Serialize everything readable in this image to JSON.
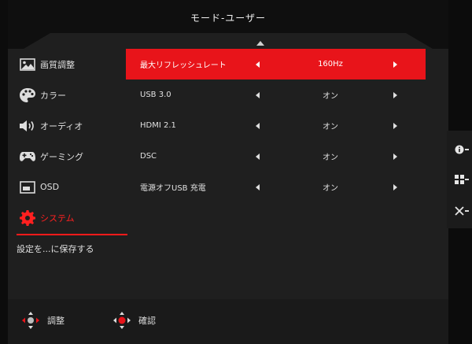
{
  "header": {
    "title": "モード-ユーザー"
  },
  "sidebar": {
    "items": [
      {
        "label": "画質調整",
        "icon": "image-icon"
      },
      {
        "label": "カラー",
        "icon": "palette-icon"
      },
      {
        "label": "オーディオ",
        "icon": "speaker-icon"
      },
      {
        "label": "ゲーミング",
        "icon": "gamepad-icon"
      },
      {
        "label": "OSD",
        "icon": "osd-window-icon"
      },
      {
        "label": "システム",
        "icon": "gear-icon",
        "active": true
      }
    ],
    "save_label": "設定を...に保存する"
  },
  "settings": {
    "rows": [
      {
        "label": "最大リフレッシュレート",
        "value": "160Hz",
        "active": true
      },
      {
        "label": "USB 3.0",
        "value": "オン"
      },
      {
        "label": "HDMI 2.1",
        "value": "オン"
      },
      {
        "label": "DSC",
        "value": "オン"
      },
      {
        "label": "電源オフUSB 充電",
        "value": "オン"
      }
    ]
  },
  "footer": {
    "adjust_label": "調整",
    "confirm_label": "確認"
  },
  "side_panel": {
    "buttons": [
      "info-icon",
      "menu-grid-icon",
      "close-icon"
    ]
  },
  "colors": {
    "accent": "#e8141a",
    "panel": "#1f1f1f",
    "header": "#0f0f0f"
  }
}
